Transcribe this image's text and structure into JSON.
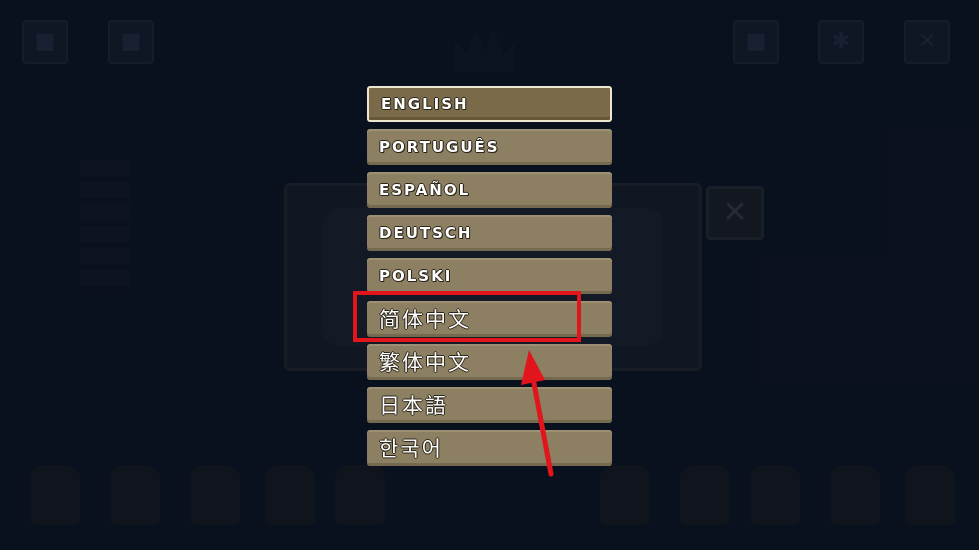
{
  "languages": [
    {
      "label": "ENGLISH",
      "script": "latin",
      "selected": true
    },
    {
      "label": "PORTUGUÊS",
      "script": "latin",
      "selected": false
    },
    {
      "label": "ESPAÑOL",
      "script": "latin",
      "selected": false
    },
    {
      "label": "DEUTSCH",
      "script": "latin",
      "selected": false
    },
    {
      "label": "POLSKI",
      "script": "latin",
      "selected": false
    },
    {
      "label": "简体中文",
      "script": "cjk",
      "selected": false
    },
    {
      "label": "繁体中文",
      "script": "cjk",
      "selected": false
    },
    {
      "label": "日本語",
      "script": "cjk",
      "selected": false
    },
    {
      "label": "한국어",
      "script": "cjk",
      "selected": false
    }
  ],
  "annotation": {
    "highlighted_option": "简体中文",
    "color": "#e3151c"
  },
  "colors": {
    "button": "#8c7f62",
    "button_selected": "#7a6a4a",
    "background": "#0f1727"
  },
  "background_icons": [
    "gamepad-icon",
    "bag-icon",
    "profile-icon",
    "gear-icon",
    "close-icon"
  ],
  "background_dialog": {
    "close_glyph": "✕"
  }
}
